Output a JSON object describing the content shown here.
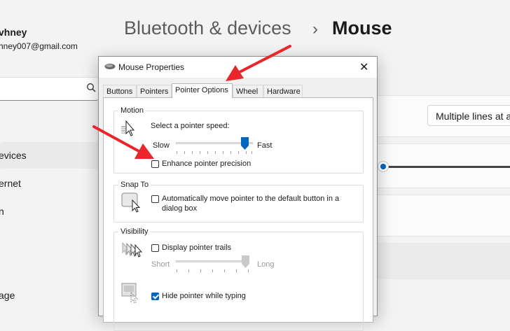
{
  "settings": {
    "user": {
      "name": "vhney",
      "email": "hney007@gmail.com"
    },
    "breadcrumb": {
      "parent": "Bluetooth & devices",
      "separator": "›",
      "current": "Mouse"
    },
    "nav": [
      {
        "label": "evices"
      },
      {
        "label": "ernet"
      },
      {
        "label": "n"
      },
      {
        "label": "age"
      }
    ],
    "dropdown_value": "Multiple lines at a",
    "accent": "#0067c0"
  },
  "dialog": {
    "title": "Mouse Properties",
    "close_glyph": "✕",
    "tabs": [
      {
        "label": "Buttons"
      },
      {
        "label": "Pointers"
      },
      {
        "label": "Pointer Options"
      },
      {
        "label": "Wheel"
      },
      {
        "label": "Hardware"
      }
    ],
    "active_tab": "Pointer Options",
    "motion": {
      "label": "Motion",
      "speed_prompt": "Select a pointer speed:",
      "slow": "Slow",
      "fast": "Fast",
      "speed_value_fraction": 0.9,
      "enhance_label": "Enhance pointer precision",
      "enhance_checked": false
    },
    "snap_to": {
      "label": "Snap To",
      "auto_move_label_line1": "Automatically move pointer to the default button in a",
      "auto_move_label_line2": "dialog box",
      "checked": false
    },
    "visibility": {
      "label": "Visibility",
      "trails_label": "Display pointer trails",
      "trails_checked": false,
      "short": "Short",
      "long": "Long",
      "trail_length_fraction": 1.0,
      "hide_label": "Hide pointer while typing",
      "hide_checked": true
    }
  },
  "annotations": {
    "arrow_color": "#e8262b"
  }
}
